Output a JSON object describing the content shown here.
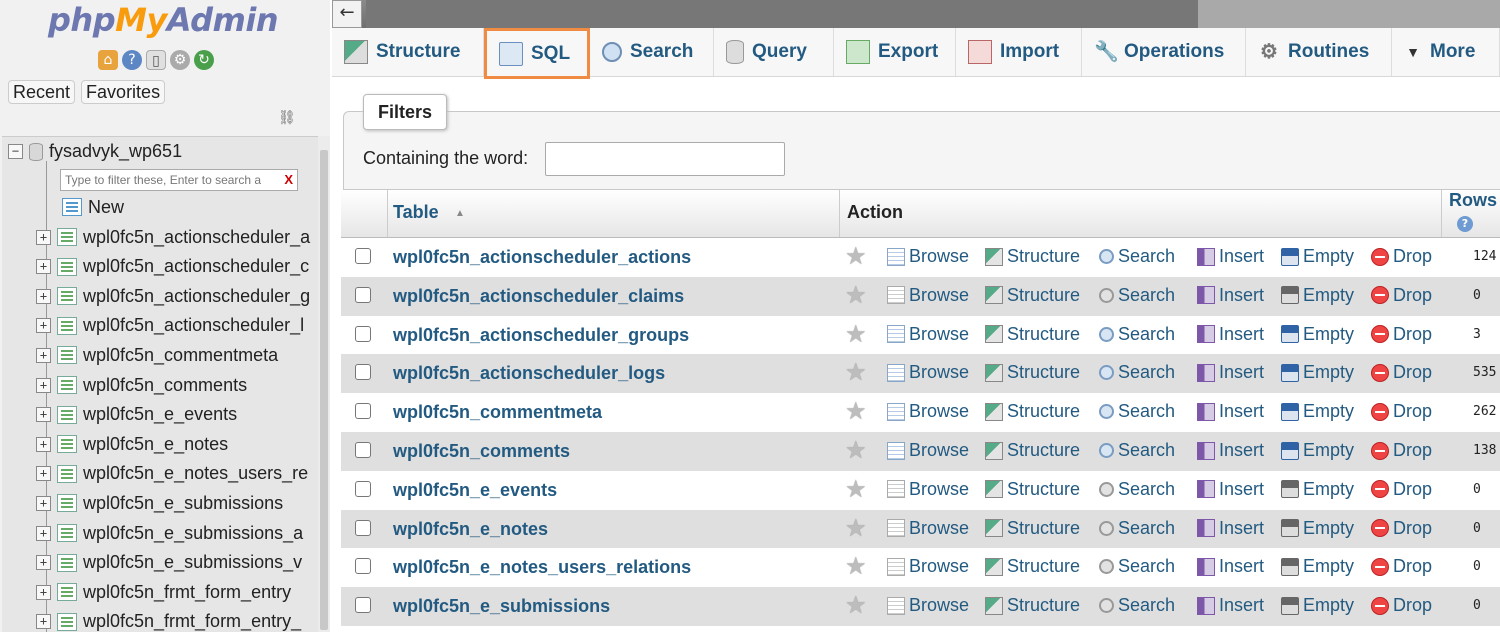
{
  "nav": {
    "logo": {
      "php": "php",
      "my": "My",
      "admin": "Admin"
    },
    "icons": [
      "home-icon",
      "help-icon",
      "docs-icon",
      "settings-icon",
      "reload-icon"
    ],
    "tabs": [
      "Recent",
      "Favorites"
    ],
    "database": "fysadvyk_wp651",
    "filter_placeholder": "Type to filter these, Enter to search a",
    "filter_clear": "X",
    "new_label": "New",
    "tables": [
      "wpl0fc5n_actionscheduler_a",
      "wpl0fc5n_actionscheduler_c",
      "wpl0fc5n_actionscheduler_g",
      "wpl0fc5n_actionscheduler_l",
      "wpl0fc5n_commentmeta",
      "wpl0fc5n_comments",
      "wpl0fc5n_e_events",
      "wpl0fc5n_e_notes",
      "wpl0fc5n_e_notes_users_re",
      "wpl0fc5n_e_submissions",
      "wpl0fc5n_e_submissions_a",
      "wpl0fc5n_e_submissions_v",
      "wpl0fc5n_frmt_form_entry",
      "wpl0fc5n_frmt_form_entry_"
    ]
  },
  "topbar": {
    "back": "←"
  },
  "menu": [
    {
      "label": "Structure",
      "icon": "structure-icon",
      "active": false
    },
    {
      "label": "SQL",
      "icon": "sql-icon",
      "active": true
    },
    {
      "label": "Search",
      "icon": "search-icon",
      "active": false
    },
    {
      "label": "Query",
      "icon": "query-icon",
      "active": false
    },
    {
      "label": "Export",
      "icon": "export-icon",
      "active": false
    },
    {
      "label": "Import",
      "icon": "import-icon",
      "active": false
    },
    {
      "label": "Operations",
      "icon": "wrench-icon",
      "active": false
    },
    {
      "label": "Routines",
      "icon": "gears-icon",
      "active": false
    },
    {
      "label": "More",
      "icon": "triangle-down-icon",
      "active": false
    }
  ],
  "filters": {
    "legend": "Filters",
    "label": "Containing the word:",
    "value": ""
  },
  "table": {
    "headers": {
      "table": "Table",
      "action": "Action",
      "rows": "Rows"
    },
    "actions": [
      "Browse",
      "Structure",
      "Search",
      "Insert",
      "Empty",
      "Drop"
    ],
    "rows": [
      {
        "name": "wpl0fc5n_actionscheduler_actions",
        "rows": "124",
        "empty": false
      },
      {
        "name": "wpl0fc5n_actionscheduler_claims",
        "rows": "0",
        "empty": true
      },
      {
        "name": "wpl0fc5n_actionscheduler_groups",
        "rows": "3",
        "empty": false
      },
      {
        "name": "wpl0fc5n_actionscheduler_logs",
        "rows": "535",
        "empty": false
      },
      {
        "name": "wpl0fc5n_commentmeta",
        "rows": "262",
        "empty": false
      },
      {
        "name": "wpl0fc5n_comments",
        "rows": "138",
        "empty": false
      },
      {
        "name": "wpl0fc5n_e_events",
        "rows": "0",
        "empty": true
      },
      {
        "name": "wpl0fc5n_e_notes",
        "rows": "0",
        "empty": true
      },
      {
        "name": "wpl0fc5n_e_notes_users_relations",
        "rows": "0",
        "empty": true
      },
      {
        "name": "wpl0fc5n_e_submissions",
        "rows": "0",
        "empty": true
      }
    ]
  },
  "colors": {
    "link": "#235a81",
    "active_tab_border": "#f08b43",
    "row_alt": "#dfdfdf"
  }
}
